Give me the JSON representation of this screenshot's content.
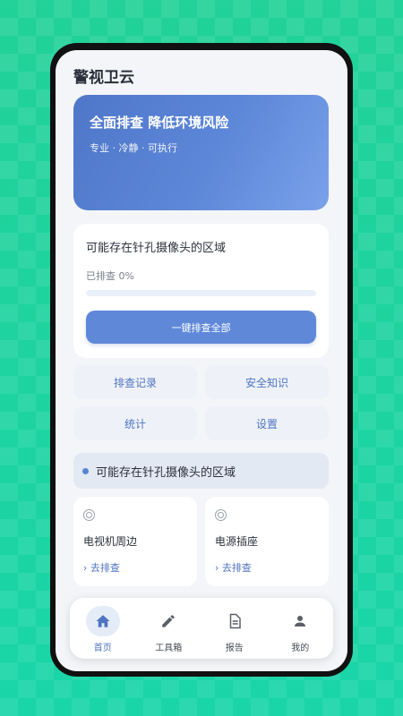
{
  "app": {
    "title": "警视卫云"
  },
  "hero": {
    "title": "全面排查 降低环境风险",
    "subtitle": "专业 · 冷静 · 可执行"
  },
  "scan": {
    "title": "可能存在针孔摄像头的区域",
    "progress_text": "已排查 0%",
    "progress": 0,
    "button_label": "一键排查全部"
  },
  "actions": [
    {
      "label": "排查记录"
    },
    {
      "label": "安全知识"
    },
    {
      "label": "统计"
    },
    {
      "label": "设置"
    }
  ],
  "section": {
    "title": "可能存在针孔摄像头的区域"
  },
  "areas": [
    {
      "name": "电视机周边",
      "link": "› 去排查",
      "icon": "target-icon"
    },
    {
      "name": "电源插座",
      "link": "› 去排查",
      "icon": "target-icon"
    }
  ],
  "tabs": [
    {
      "label": "首页",
      "icon": "home-icon",
      "active": true
    },
    {
      "label": "工具箱",
      "icon": "pencil-icon",
      "active": false
    },
    {
      "label": "报告",
      "icon": "document-icon",
      "active": false
    },
    {
      "label": "我的",
      "icon": "person-icon",
      "active": false
    }
  ],
  "colors": {
    "accent": "#5b83d6",
    "hero_start": "#4e77c9",
    "hero_end": "#7aa2ea",
    "background": "#22d39d"
  }
}
